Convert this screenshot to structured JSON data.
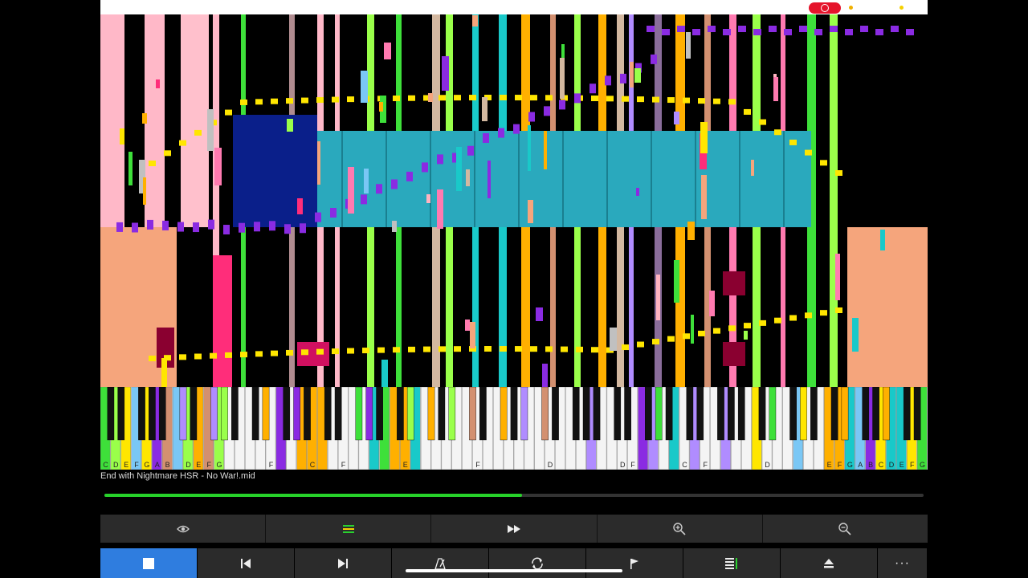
{
  "file": {
    "name": "End with Nightmare HSR - No War!.mid"
  },
  "playback": {
    "progress": 0.51,
    "state": "playing"
  },
  "colors": {
    "accent": "#2f7ddf",
    "progress": "#27d12a",
    "record": "#e5142b",
    "toolbar": "#2b2b2b"
  },
  "keyboard": {
    "visible_note_labels": [
      {
        "key": 0,
        "label": "C"
      },
      {
        "key": 1,
        "label": "D"
      },
      {
        "key": 2,
        "label": "E"
      },
      {
        "key": 3,
        "label": "F"
      },
      {
        "key": 4,
        "label": "G"
      },
      {
        "key": 5,
        "label": "A"
      },
      {
        "key": 6,
        "label": "B"
      },
      {
        "key": 8,
        "label": "D"
      },
      {
        "key": 9,
        "label": "E"
      },
      {
        "key": 10,
        "label": "F"
      },
      {
        "key": 11,
        "label": "G"
      },
      {
        "key": 16,
        "label": "F"
      },
      {
        "key": 20,
        "label": "C"
      },
      {
        "key": 23,
        "label": "F"
      },
      {
        "key": 29,
        "label": "E"
      },
      {
        "key": 36,
        "label": "F"
      },
      {
        "key": 43,
        "label": "D"
      },
      {
        "key": 50,
        "label": "D"
      },
      {
        "key": 51,
        "label": "F"
      },
      {
        "key": 56,
        "label": "C"
      },
      {
        "key": 58,
        "label": "F"
      },
      {
        "key": 64,
        "label": "D"
      },
      {
        "key": 70,
        "label": "E"
      },
      {
        "key": 71,
        "label": "F"
      },
      {
        "key": 72,
        "label": "G"
      },
      {
        "key": 73,
        "label": "A"
      },
      {
        "key": 74,
        "label": "B"
      },
      {
        "key": 75,
        "label": "C"
      },
      {
        "key": 76,
        "label": "D"
      },
      {
        "key": 77,
        "label": "E"
      },
      {
        "key": 78,
        "label": "F"
      },
      {
        "key": 79,
        "label": "G"
      }
    ]
  },
  "toolbar_top": [
    {
      "name": "visibility-button",
      "icon": "eye-icon"
    },
    {
      "name": "tracks-button",
      "icon": "equals-icon"
    },
    {
      "name": "fast-forward-button",
      "icon": "fast-forward-icon"
    },
    {
      "name": "zoom-in-button",
      "icon": "zoom-in-icon"
    },
    {
      "name": "zoom-out-button",
      "icon": "zoom-out-icon"
    }
  ],
  "toolbar_bottom": [
    {
      "name": "stop-button",
      "icon": "stop-icon",
      "active": true
    },
    {
      "name": "previous-button",
      "icon": "skip-previous-icon"
    },
    {
      "name": "next-button",
      "icon": "skip-next-icon"
    },
    {
      "name": "tempo-button",
      "icon": "metronome-icon"
    },
    {
      "name": "loop-button",
      "icon": "loop-icon"
    },
    {
      "name": "marker-button",
      "icon": "flag-icon"
    },
    {
      "name": "playlist-button",
      "icon": "list-icon"
    },
    {
      "name": "eject-button",
      "icon": "eject-icon"
    },
    {
      "name": "more-button",
      "icon": "more-icon",
      "label": "···"
    }
  ]
}
